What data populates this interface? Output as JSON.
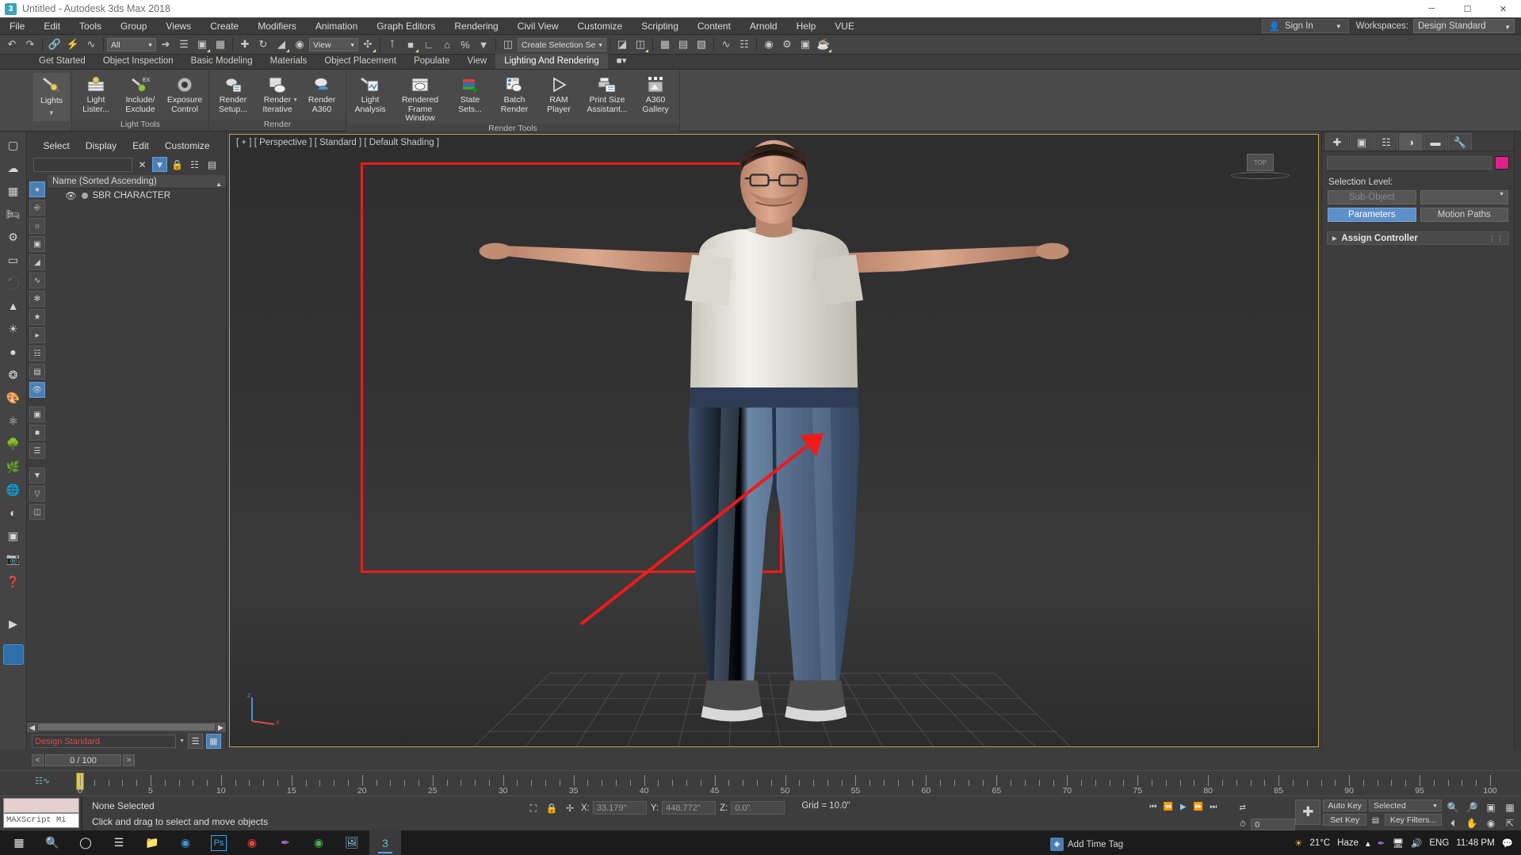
{
  "titlebar": {
    "icon": "max-app-icon",
    "title": "Untitled - Autodesk 3ds Max 2018",
    "minimize": "─",
    "maximize": "☐",
    "close": "✕"
  },
  "menubar": {
    "items": [
      "File",
      "Edit",
      "Tools",
      "Group",
      "Views",
      "Create",
      "Modifiers",
      "Animation",
      "Graph Editors",
      "Rendering",
      "Civil View",
      "Customize",
      "Scripting",
      "Content",
      "Arnold",
      "Help",
      "VUE"
    ],
    "signin": "Sign In",
    "workspaces_label": "Workspaces:",
    "workspace_value": "Design Standard"
  },
  "toolbar": {
    "selection_filter": "All",
    "view_dropdown": "View",
    "named_selection": "Create Selection Se"
  },
  "ribbon": {
    "tabs": [
      "Get Started",
      "Object Inspection",
      "Basic Modeling",
      "Materials",
      "Object Placement",
      "Populate",
      "View",
      "Lighting And Rendering"
    ],
    "active_tab": "Lighting And Rendering",
    "panels": [
      {
        "title": "Light Tools",
        "big": {
          "label": "Lights"
        },
        "buttons": [
          {
            "label": "Light\nLister..."
          },
          {
            "label": "Include/\nExclude"
          },
          {
            "label": "Exposure\nControl"
          }
        ]
      },
      {
        "title": "Render",
        "buttons": [
          {
            "label": "Render\nSetup..."
          },
          {
            "label": "Render\nIterative"
          },
          {
            "label": "Render\nA360"
          }
        ]
      },
      {
        "title": "Render Tools",
        "buttons": [
          {
            "label": "Light\nAnalysis"
          },
          {
            "label": "Rendered\nFrame Window"
          },
          {
            "label": "State\nSets..."
          },
          {
            "label": "Batch\nRender"
          },
          {
            "label": "RAM\nPlayer"
          },
          {
            "label": "Print Size\nAssistant..."
          },
          {
            "label": "A360\nGallery"
          }
        ]
      }
    ]
  },
  "explorer": {
    "menus": [
      "Select",
      "Display",
      "Edit",
      "Customize"
    ],
    "search_value": "",
    "clear_icon": "✕",
    "column_header": "Name (Sorted Ascending)",
    "rows": [
      {
        "name": "SBR CHARACTER",
        "visible": true
      }
    ],
    "workspace_field": "Design Standard"
  },
  "viewport": {
    "label": "[ + ] [ Perspective ] [ Standard ] [ Default Shading ]",
    "viewcube_label": "TOP",
    "annotation": {
      "box_color": "#f01a1a",
      "arrow_color": "#f01a1a"
    }
  },
  "command_panel": {
    "tabs": [
      "create-tab",
      "modify-tab",
      "hierarchy-tab",
      "motion-tab",
      "display-tab",
      "utilities-tab"
    ],
    "active_tab_index": 3,
    "object_name": "",
    "color_swatch": "#e01f8b",
    "selection_level_label": "Selection Level:",
    "sub_object": "Sub-Object",
    "sub_object_dropdown": "",
    "parameters": "Parameters",
    "motion_paths": "Motion Paths",
    "assign_controller": "Assign Controller"
  },
  "timeline": {
    "prev": "<",
    "frame_display": "0 / 100",
    "next": ">",
    "ticks": [
      0,
      5,
      10,
      15,
      20,
      25,
      30,
      35,
      40,
      45,
      50,
      55,
      60,
      65,
      70,
      75,
      80,
      85,
      90,
      95,
      100
    ],
    "current_frame": 0
  },
  "statusbar": {
    "maxscript_label": "MAXScript Mi",
    "selection_status": "None Selected",
    "prompt": "Click and drag to select and move objects",
    "x_label": "X:",
    "x_value": "33.179\"",
    "y_label": "Y:",
    "y_value": "448.772\"",
    "z_label": "Z:",
    "z_value": "0.0\"",
    "grid": "Grid = 10.0\"",
    "add_time_tag": "Add Time Tag",
    "auto_key": "Auto Key",
    "set_key": "Set Key",
    "key_mode": "Selected",
    "key_filters": "Key Filters..."
  },
  "taskbar": {
    "apps": [
      "start-icon",
      "search-icon",
      "cortana-icon",
      "task-view-icon",
      "file-explorer-icon",
      "edge-icon",
      "photoshop-icon",
      "chrome-icon",
      "feather-icon",
      "chrome2-icon",
      "photos-icon",
      "max-icon"
    ],
    "temperature": "21°C",
    "weather": "Haze",
    "language": "ENG",
    "time": "11:48 PM"
  }
}
